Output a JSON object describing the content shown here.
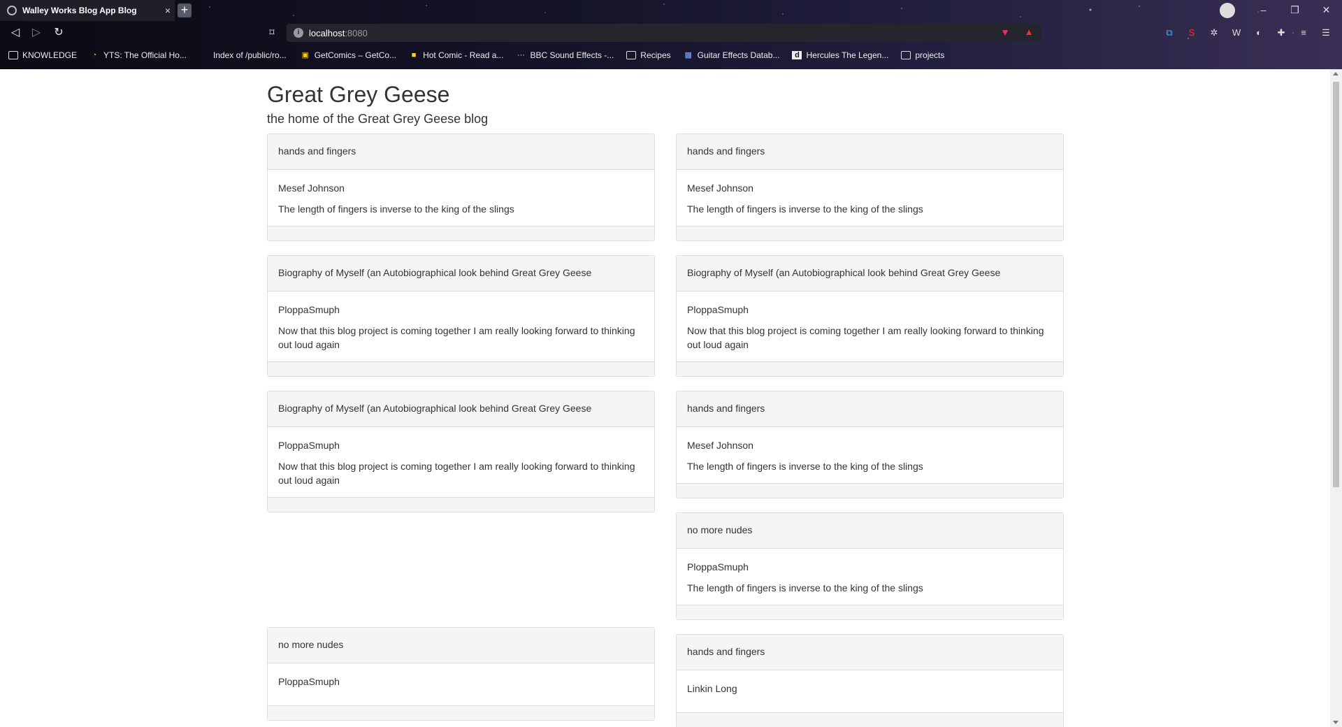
{
  "browser": {
    "tab_title": "Walley Works Blog App Blog",
    "tab_close": "×",
    "new_tab": "+",
    "url_host": "localhost",
    "url_port": ":8080",
    "window_controls": [
      "–",
      "❐",
      "✕"
    ],
    "bookmarks": [
      {
        "label": "KNOWLEDGE",
        "icon": "folder-icon"
      },
      {
        "label": "YTS: The Official Ho...",
        "icon": "yts-icon"
      },
      {
        "label": "Index of /public/ro...",
        "icon": "blank-icon"
      },
      {
        "label": "GetComics – GetCo...",
        "icon": "getcomics-icon"
      },
      {
        "label": "Hot Comic - Read a...",
        "icon": "hotcomic-icon"
      },
      {
        "label": "BBC Sound Effects -...",
        "icon": "bbc-icon"
      },
      {
        "label": "Recipes",
        "icon": "folder-icon"
      },
      {
        "label": "Guitar Effects Datab...",
        "icon": "guitar-icon"
      },
      {
        "label": "Hercules The Legen...",
        "icon": "d-icon"
      },
      {
        "label": "projects",
        "icon": "folder-icon"
      }
    ]
  },
  "site": {
    "title": "Great Grey Geese",
    "subtitle": "the home of the Great Grey Geese blog"
  },
  "posts_left": [
    {
      "title": "hands and fingers",
      "author": "Mesef Johnson",
      "body": "The length of fingers is inverse to the king of the slings"
    },
    {
      "title": "Biography of Myself (an Autobiographical look behind Great Grey Geese",
      "author": "PloppaSmuph",
      "body": "Now that this blog project is coming together I am really looking forward to thinking out loud again"
    },
    {
      "title": "Biography of Myself (an Autobiographical look behind Great Grey Geese",
      "author": "PloppaSmuph",
      "body": "Now that this blog project is coming together I am really looking forward to thinking out loud again"
    },
    {
      "title": "no more nudes",
      "author": "PloppaSmuph",
      "body": ""
    }
  ],
  "posts_right": [
    {
      "title": "hands and fingers",
      "author": "Mesef Johnson",
      "body": "The length of fingers is inverse to the king of the slings"
    },
    {
      "title": "Biography of Myself (an Autobiographical look behind Great Grey Geese",
      "author": "PloppaSmuph",
      "body": "Now that this blog project is coming together I am really looking forward to thinking out loud again"
    },
    {
      "title": "hands and fingers",
      "author": "Mesef Johnson",
      "body": "The length of fingers is inverse to the king of the slings"
    },
    {
      "title": "no more nudes",
      "author": "PloppaSmuph",
      "body": "The length of fingers is inverse to the king of the slings"
    },
    {
      "title": "hands and fingers",
      "author": "Linkin Long",
      "body": ""
    }
  ]
}
